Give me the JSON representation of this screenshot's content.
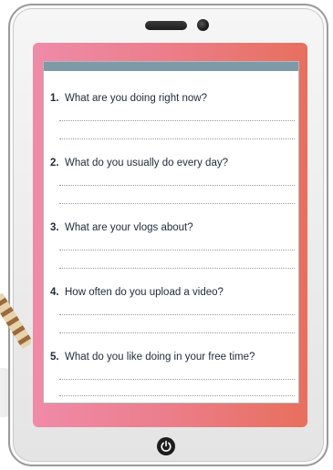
{
  "worksheet": {
    "questions": [
      {
        "number": "1.",
        "text": "What are you doing right now?"
      },
      {
        "number": "2.",
        "text": "What do you usually do every day?"
      },
      {
        "number": "3.",
        "text": "What are your vlogs about?"
      },
      {
        "number": "4.",
        "text": "How often do you upload a video?"
      },
      {
        "number": "5.",
        "text": "What do you like doing in your free time?"
      }
    ]
  },
  "colors": {
    "frame_left": "#ef8aa8",
    "frame_right": "#e86f5d",
    "header_bar": "#7e9aa8",
    "text": "#1f2a3a"
  },
  "icons": {
    "home": "power-icon"
  }
}
